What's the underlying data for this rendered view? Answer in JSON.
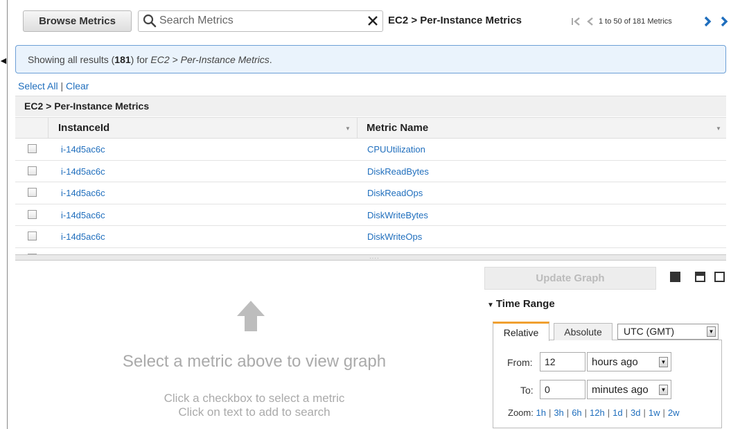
{
  "toolbar": {
    "browse_label": "Browse Metrics",
    "search_placeholder": "Search Metrics",
    "search_value": "",
    "current_namespace": "EC2 > Per-Instance Metrics",
    "pager_text": "1 to 50 of 181 Metrics"
  },
  "banner": {
    "prefix": "Showing all results (",
    "count": "181",
    "middle": ") for ",
    "namespace": "EC2 > Per-Instance Metrics",
    "suffix": "."
  },
  "selection": {
    "select_all": "Select All",
    "separator": "|",
    "clear": "Clear"
  },
  "table": {
    "group_title": "EC2 > Per-Instance Metrics",
    "columns": [
      "InstanceId",
      "Metric Name"
    ],
    "rows": [
      {
        "instance": "i-14d5ac6c",
        "metric": "CPUUtilization"
      },
      {
        "instance": "i-14d5ac6c",
        "metric": "DiskReadBytes"
      },
      {
        "instance": "i-14d5ac6c",
        "metric": "DiskReadOps"
      },
      {
        "instance": "i-14d5ac6c",
        "metric": "DiskWriteBytes"
      },
      {
        "instance": "i-14d5ac6c",
        "metric": "DiskWriteOps"
      }
    ]
  },
  "graph_area": {
    "title": "Select a metric above to view graph",
    "hint1": "Click a checkbox to select a metric",
    "hint2": "Click on text to add to search"
  },
  "controls": {
    "update_label": "Update Graph",
    "time_range_label": "Time Range",
    "tabs": [
      "Relative",
      "Absolute"
    ],
    "active_tab": "Relative",
    "timezone": "UTC (GMT)",
    "from_label": "From:",
    "from_value": "12",
    "from_unit": "hours ago",
    "to_label": "To:",
    "to_value": "0",
    "to_unit": "minutes ago",
    "zoom_label": "Zoom:",
    "zoom_options": [
      "1h",
      "3h",
      "6h",
      "12h",
      "1d",
      "3d",
      "1w",
      "2w"
    ]
  },
  "colors": {
    "link": "#1f6ebd",
    "banner_bg": "#eaf3fc",
    "banner_border": "#6c9fd6",
    "tab_accent": "#f0a030"
  }
}
